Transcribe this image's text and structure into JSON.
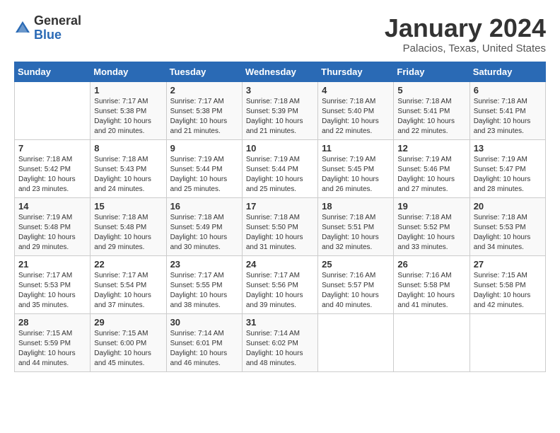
{
  "logo": {
    "general": "General",
    "blue": "Blue"
  },
  "header": {
    "title": "January 2024",
    "subtitle": "Palacios, Texas, United States"
  },
  "weekdays": [
    "Sunday",
    "Monday",
    "Tuesday",
    "Wednesday",
    "Thursday",
    "Friday",
    "Saturday"
  ],
  "weeks": [
    [
      {
        "day": "",
        "info": ""
      },
      {
        "day": "1",
        "info": "Sunrise: 7:17 AM\nSunset: 5:38 PM\nDaylight: 10 hours\nand 20 minutes."
      },
      {
        "day": "2",
        "info": "Sunrise: 7:17 AM\nSunset: 5:38 PM\nDaylight: 10 hours\nand 21 minutes."
      },
      {
        "day": "3",
        "info": "Sunrise: 7:18 AM\nSunset: 5:39 PM\nDaylight: 10 hours\nand 21 minutes."
      },
      {
        "day": "4",
        "info": "Sunrise: 7:18 AM\nSunset: 5:40 PM\nDaylight: 10 hours\nand 22 minutes."
      },
      {
        "day": "5",
        "info": "Sunrise: 7:18 AM\nSunset: 5:41 PM\nDaylight: 10 hours\nand 22 minutes."
      },
      {
        "day": "6",
        "info": "Sunrise: 7:18 AM\nSunset: 5:41 PM\nDaylight: 10 hours\nand 23 minutes."
      }
    ],
    [
      {
        "day": "7",
        "info": "Sunrise: 7:18 AM\nSunset: 5:42 PM\nDaylight: 10 hours\nand 23 minutes."
      },
      {
        "day": "8",
        "info": "Sunrise: 7:18 AM\nSunset: 5:43 PM\nDaylight: 10 hours\nand 24 minutes."
      },
      {
        "day": "9",
        "info": "Sunrise: 7:19 AM\nSunset: 5:44 PM\nDaylight: 10 hours\nand 25 minutes."
      },
      {
        "day": "10",
        "info": "Sunrise: 7:19 AM\nSunset: 5:44 PM\nDaylight: 10 hours\nand 25 minutes."
      },
      {
        "day": "11",
        "info": "Sunrise: 7:19 AM\nSunset: 5:45 PM\nDaylight: 10 hours\nand 26 minutes."
      },
      {
        "day": "12",
        "info": "Sunrise: 7:19 AM\nSunset: 5:46 PM\nDaylight: 10 hours\nand 27 minutes."
      },
      {
        "day": "13",
        "info": "Sunrise: 7:19 AM\nSunset: 5:47 PM\nDaylight: 10 hours\nand 28 minutes."
      }
    ],
    [
      {
        "day": "14",
        "info": "Sunrise: 7:19 AM\nSunset: 5:48 PM\nDaylight: 10 hours\nand 29 minutes."
      },
      {
        "day": "15",
        "info": "Sunrise: 7:18 AM\nSunset: 5:48 PM\nDaylight: 10 hours\nand 29 minutes."
      },
      {
        "day": "16",
        "info": "Sunrise: 7:18 AM\nSunset: 5:49 PM\nDaylight: 10 hours\nand 30 minutes."
      },
      {
        "day": "17",
        "info": "Sunrise: 7:18 AM\nSunset: 5:50 PM\nDaylight: 10 hours\nand 31 minutes."
      },
      {
        "day": "18",
        "info": "Sunrise: 7:18 AM\nSunset: 5:51 PM\nDaylight: 10 hours\nand 32 minutes."
      },
      {
        "day": "19",
        "info": "Sunrise: 7:18 AM\nSunset: 5:52 PM\nDaylight: 10 hours\nand 33 minutes."
      },
      {
        "day": "20",
        "info": "Sunrise: 7:18 AM\nSunset: 5:53 PM\nDaylight: 10 hours\nand 34 minutes."
      }
    ],
    [
      {
        "day": "21",
        "info": "Sunrise: 7:17 AM\nSunset: 5:53 PM\nDaylight: 10 hours\nand 35 minutes."
      },
      {
        "day": "22",
        "info": "Sunrise: 7:17 AM\nSunset: 5:54 PM\nDaylight: 10 hours\nand 37 minutes."
      },
      {
        "day": "23",
        "info": "Sunrise: 7:17 AM\nSunset: 5:55 PM\nDaylight: 10 hours\nand 38 minutes."
      },
      {
        "day": "24",
        "info": "Sunrise: 7:17 AM\nSunset: 5:56 PM\nDaylight: 10 hours\nand 39 minutes."
      },
      {
        "day": "25",
        "info": "Sunrise: 7:16 AM\nSunset: 5:57 PM\nDaylight: 10 hours\nand 40 minutes."
      },
      {
        "day": "26",
        "info": "Sunrise: 7:16 AM\nSunset: 5:58 PM\nDaylight: 10 hours\nand 41 minutes."
      },
      {
        "day": "27",
        "info": "Sunrise: 7:15 AM\nSunset: 5:58 PM\nDaylight: 10 hours\nand 42 minutes."
      }
    ],
    [
      {
        "day": "28",
        "info": "Sunrise: 7:15 AM\nSunset: 5:59 PM\nDaylight: 10 hours\nand 44 minutes."
      },
      {
        "day": "29",
        "info": "Sunrise: 7:15 AM\nSunset: 6:00 PM\nDaylight: 10 hours\nand 45 minutes."
      },
      {
        "day": "30",
        "info": "Sunrise: 7:14 AM\nSunset: 6:01 PM\nDaylight: 10 hours\nand 46 minutes."
      },
      {
        "day": "31",
        "info": "Sunrise: 7:14 AM\nSunset: 6:02 PM\nDaylight: 10 hours\nand 48 minutes."
      },
      {
        "day": "",
        "info": ""
      },
      {
        "day": "",
        "info": ""
      },
      {
        "day": "",
        "info": ""
      }
    ]
  ]
}
